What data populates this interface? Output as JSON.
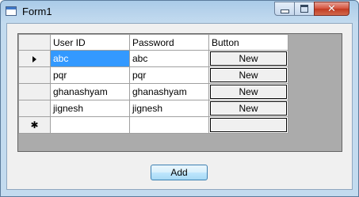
{
  "window": {
    "title": "Form1",
    "controls": {
      "minimize_icon": "minimize-icon",
      "maximize_icon": "maximize-icon",
      "close_icon": "close-icon"
    }
  },
  "grid": {
    "columns": [
      "User ID",
      "Password",
      "Button"
    ],
    "rows": [
      {
        "user_id": "abc",
        "password": "abc",
        "button": "New"
      },
      {
        "user_id": "pqr",
        "password": "pqr",
        "button": "New"
      },
      {
        "user_id": "ghanashyam",
        "password": "ghanashyam",
        "button": "New"
      },
      {
        "user_id": "jignesh",
        "password": "jignesh",
        "button": "New"
      }
    ],
    "current_row_icon": "current-row-arrow-icon",
    "new_row_icon": "new-row-asterisk-icon",
    "new_row_glyph": "✱",
    "selected_cell": "row 1, User ID",
    "selection_color": "#3399ff"
  },
  "add_button": {
    "label": "Add"
  }
}
